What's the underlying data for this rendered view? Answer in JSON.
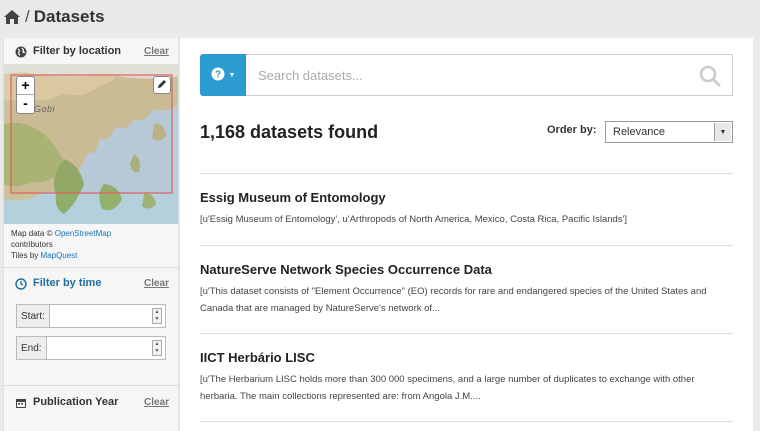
{
  "breadcrumb": {
    "separator": "/",
    "title": "Datasets"
  },
  "sidebar": {
    "location": {
      "title": "Filter by location",
      "clear": "Clear",
      "zoom_in": "+",
      "zoom_out": "-",
      "map_place_label": "Gobi",
      "attribution": {
        "line1_prefix": "Map data ©",
        "line1_link": "OpenStreetMap",
        "line2": "contributors",
        "line3_prefix": "Tiles by",
        "line3_link": "MapQuest"
      }
    },
    "time": {
      "title": "Filter by time",
      "clear": "Clear",
      "start_label": "Start:",
      "end_label": "End:"
    },
    "pubyear": {
      "title": "Publication Year",
      "clear": "Clear"
    }
  },
  "search": {
    "placeholder": "Search datasets...",
    "button_icon": "question-icon"
  },
  "results_header": {
    "count": "1,168 datasets found",
    "order_label": "Order by:",
    "order_value": "Relevance"
  },
  "results": [
    {
      "title": "Essig Museum of Entomology",
      "desc": "[u'Essig Museum of Entomology', u'Arthropods of North America, Mexico, Costa Rica, Pacific Islands']"
    },
    {
      "title": "NatureServe Network Species Occurrence Data",
      "desc": "[u'This dataset consists of \"Element Occurrence\" (EO) records for rare and endangered species of the United States and Canada that are managed by NatureServe's network of..."
    },
    {
      "title": "IICT Herbário LISC",
      "desc": "[u'The Herbarium LISC holds more than 300 000 specimens, and a large number of duplicates to exchange with other herbaria. The main collections represented are: from Angola J.M...."
    }
  ],
  "colors": {
    "accent": "#2a9cd1",
    "link": "#1a73b8",
    "time_title": "#1f6f9f"
  }
}
